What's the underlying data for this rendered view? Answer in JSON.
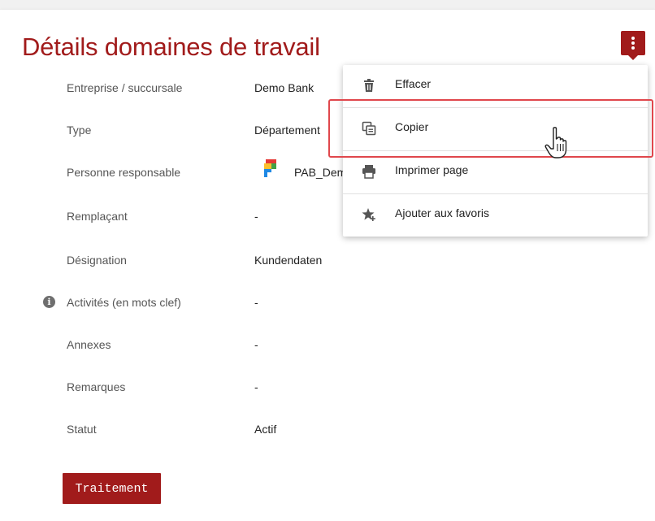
{
  "header": {
    "title": "Détails domaines de travail",
    "menu_button_icon": "more-vertical-icon"
  },
  "details": {
    "rows": [
      {
        "label": "Entreprise / succursale",
        "value": "Demo Bank"
      },
      {
        "label": "Type",
        "value": "Département"
      },
      {
        "label": "Personne responsable",
        "value": "PAB_Dem"
      },
      {
        "label": "Remplaçant",
        "value": "-"
      },
      {
        "label": "Désignation",
        "value": "Kundendaten"
      },
      {
        "label": "Activités (en mots clef)",
        "value": "-"
      },
      {
        "label": "Annexes",
        "value": "-"
      },
      {
        "label": "Remarques",
        "value": "-"
      },
      {
        "label": "Statut",
        "value": "Actif"
      }
    ],
    "info_icon": "info-icon",
    "person_icon": "pab-logo-icon"
  },
  "actions": {
    "traitement_label": "Traitement"
  },
  "menu": {
    "items": [
      {
        "label": "Effacer",
        "icon": "trash-icon"
      },
      {
        "label": "Copier",
        "icon": "copy-icon"
      },
      {
        "label": "Imprimer page",
        "icon": "print-icon"
      },
      {
        "label": "Ajouter aux favoris",
        "icon": "star-add-icon"
      }
    ]
  },
  "colors": {
    "brand": "#a11b1b",
    "highlight": "#e0474c"
  }
}
